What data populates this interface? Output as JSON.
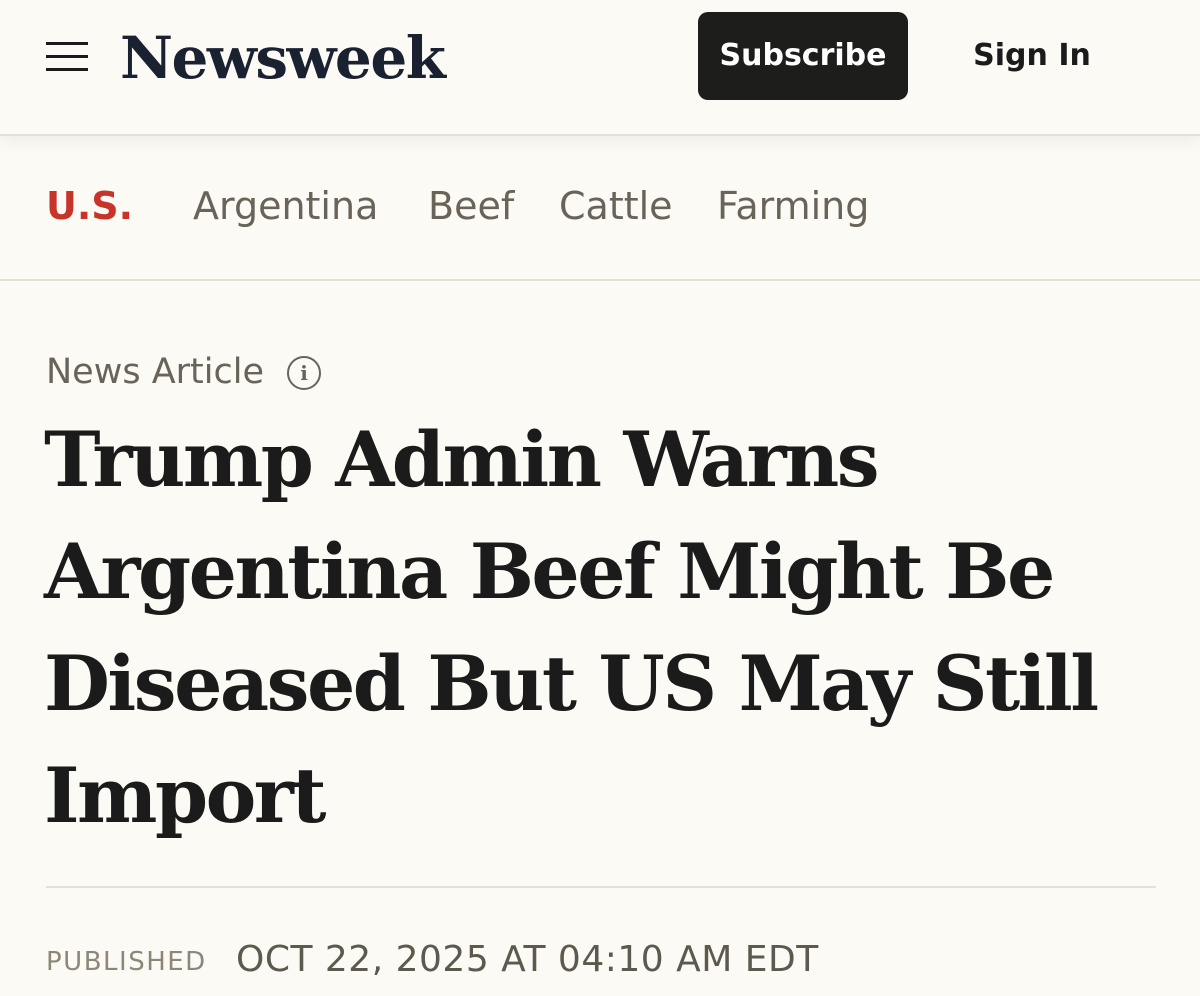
{
  "header": {
    "logo": "Newsweek",
    "subscribe_label": "Subscribe",
    "signin_label": "Sign In",
    "menu_icon": "hamburger-menu-icon"
  },
  "topics": {
    "primary": "U.S.",
    "items": [
      "Argentina",
      "Beef",
      "Cattle",
      "Farming"
    ]
  },
  "article": {
    "type_label": "News Article",
    "info_icon": "i",
    "headline": "Trump Admin Warns Argentina Beef Might Be Diseased But US May Still Import",
    "published_label": "PUBLISHED",
    "published_date": "OCT 22, 2025 AT 04:10 AM EDT"
  },
  "colors": {
    "background": "#fbfaf5",
    "primary_topic": "#c8332a",
    "subscribe_bg": "#1d1d1b"
  }
}
